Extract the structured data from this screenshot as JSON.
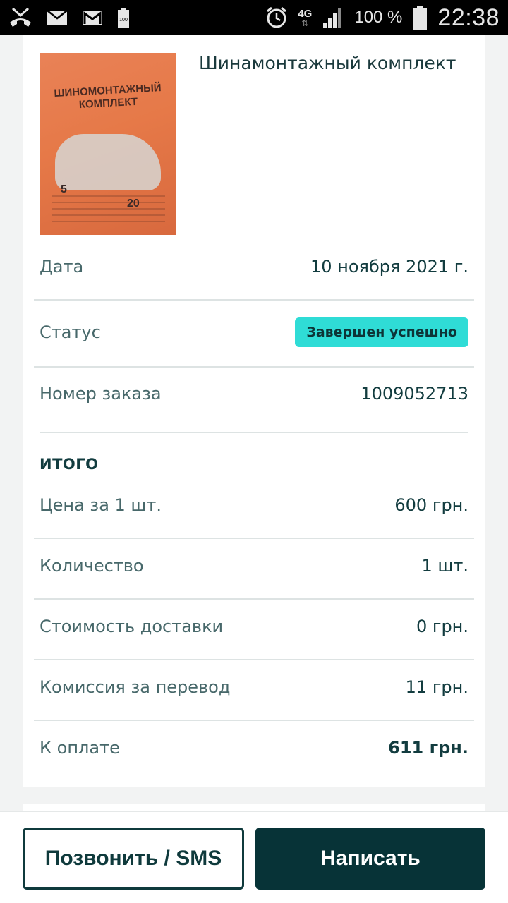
{
  "status_bar": {
    "battery_percent": "100 %",
    "network": "4G",
    "time": "22:38",
    "small_battery_label": "100"
  },
  "product": {
    "title": "Шинамонтажный комплект",
    "thumb_text": "ШИНОМОНТАЖНЫЙ КОМПЛЕКТ",
    "thumb_num_left": "5",
    "thumb_num_right": "20"
  },
  "details": {
    "date_label": "Дата",
    "date_value": "10 ноября 2021 г.",
    "status_label": "Статус",
    "status_value": "Завершен успешно",
    "order_label": "Номер заказа",
    "order_value": "1009052713"
  },
  "totals": {
    "heading": "ИТОГО",
    "price_label": "Цена за 1 шт.",
    "price_value": "600 грн.",
    "qty_label": "Количество",
    "qty_value": "1 шт.",
    "delivery_label": "Стоимость доставки",
    "delivery_value": "0 грн.",
    "fee_label": "Комиссия за перевод",
    "fee_value": "11 грн.",
    "pay_label": "К оплате",
    "pay_value": "611 грн."
  },
  "actions": {
    "call_label": "Позвонить / SMS",
    "write_label": "Написать"
  },
  "colors": {
    "accent": "#073337",
    "badge": "#2fdcd6"
  }
}
